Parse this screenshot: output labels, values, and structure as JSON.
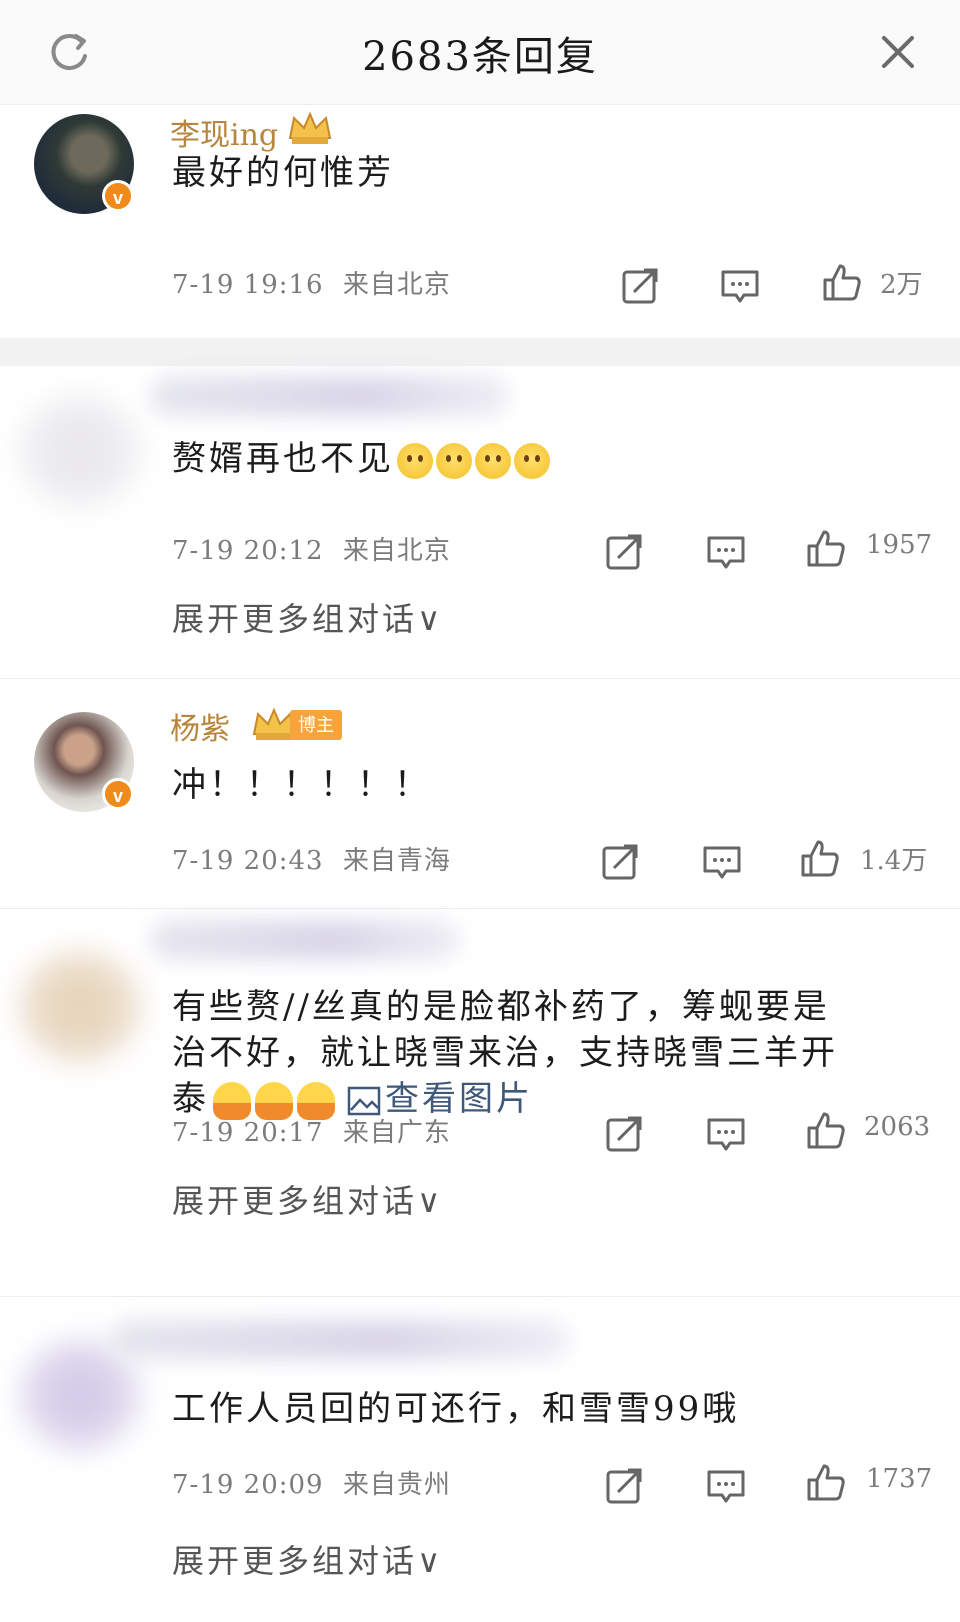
{
  "header": {
    "title": "2683条回复"
  },
  "comments": [
    {
      "username": "李现ing",
      "text": "最好的何惟芳",
      "time": "7-19 19:16",
      "location": "来自北京",
      "likes": "2万"
    },
    {
      "username": "",
      "text": "赘婿再也不见",
      "time": "7-19 20:12",
      "location": "来自北京",
      "likes": "1957",
      "expand": "展开更多组对话∨"
    },
    {
      "username": "杨紫",
      "tag": "博主",
      "text": "冲！！！！！！",
      "time": "7-19 20:43",
      "location": "来自青海",
      "likes": "1.4万"
    },
    {
      "username": "",
      "text_line1": "有些赘//丝真的是脸都补药了，筹蚬要是",
      "text_line2": "治不好，就让晓雪来治，支持晓雪三羊开",
      "text_line3": "泰",
      "image_link": "查看图片",
      "time": "7-19 20:17",
      "location": "来自广东",
      "likes": "2063",
      "expand": "展开更多组对话∨"
    },
    {
      "username": "",
      "text": "工作人员回的可还行，和雪雪99哦",
      "time": "7-19 20:09",
      "location": "来自贵州",
      "likes": "1737",
      "expand": "展开更多组对话∨"
    }
  ]
}
